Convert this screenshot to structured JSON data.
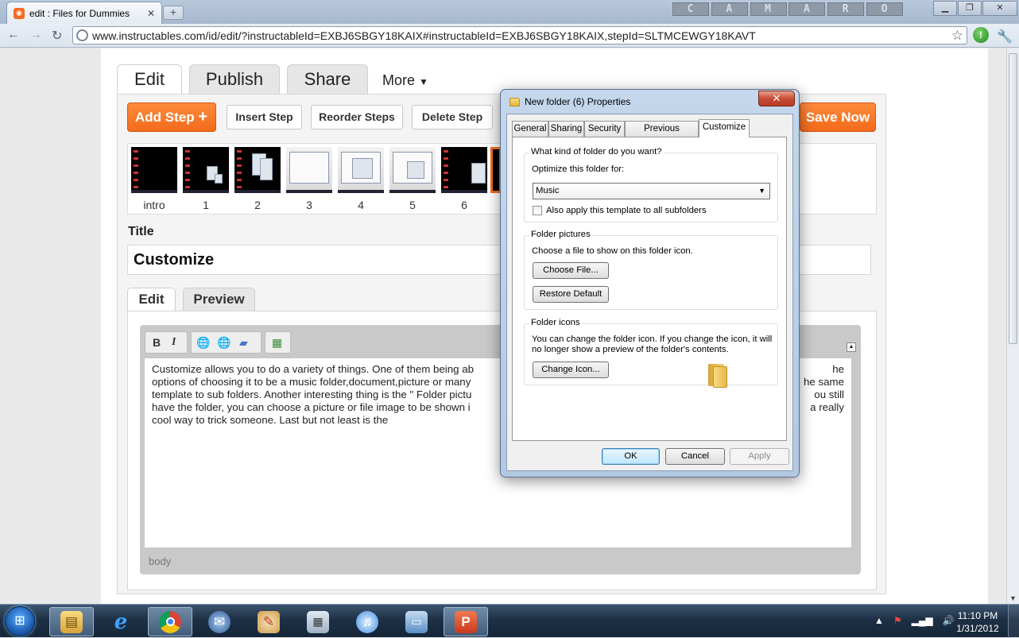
{
  "browser": {
    "tab_title": "edit : Files for Dummies",
    "tab_favicon": "instructables-logo-icon",
    "theme_logo_letters": [
      "C",
      "A",
      "M",
      "A",
      "R",
      "O"
    ],
    "url": "www.instructables.com/id/edit/?instructableId=EXBJ6SBGY18KAIX#instructableId=EXBJ6SBGY18KAIX,stepId=SLTMCEWGY18KAVT"
  },
  "page": {
    "tabs": [
      {
        "label": "Edit",
        "active": true
      },
      {
        "label": "Publish",
        "active": false
      },
      {
        "label": "Share",
        "active": false
      }
    ],
    "more_label": "More",
    "actions": {
      "add_step": "Add Step",
      "insert_step": "Insert Step",
      "reorder_steps": "Reorder Steps",
      "delete_step": "Delete Step",
      "save_now": "Save Now"
    },
    "steps": [
      {
        "label": "intro",
        "style": "dark"
      },
      {
        "label": "1",
        "style": "dark"
      },
      {
        "label": "2",
        "style": "dark"
      },
      {
        "label": "3",
        "style": "light"
      },
      {
        "label": "4",
        "style": "light"
      },
      {
        "label": "5",
        "style": "light"
      },
      {
        "label": "6",
        "style": "dark"
      }
    ],
    "title_label": "Title",
    "title_value": "Customize",
    "editor_tabs": [
      {
        "label": "Edit",
        "active": true
      },
      {
        "label": "Preview",
        "active": false
      }
    ],
    "toolbar_icons": [
      "bold-icon",
      "italic-icon",
      "link-icon",
      "unlink-icon",
      "eraser-icon",
      "media-icon"
    ],
    "body_text": "Customize allows you to do a variety of things. One of them being ab                                                                                                   he options of choosing it to be a music folder,document,picture or many                                                                                           he same template to sub folders. Another interesting thing is the \" Folder pictu                                                                                          ou still have the folder, you can choose a picture or file image to be shown i                                                                                       a really cool way to trick someone. Last but not least is the",
    "body_lines": [
      "Customize allows you to do a variety of things. One of them being ab",
      "options of choosing it to be a music folder,document,picture or many",
      "template to sub folders. Another interesting thing is the \" Folder pictu",
      "have the folder, you can choose a picture or file image to be shown i",
      "cool way to trick someone. Last but not least is the"
    ],
    "body_lines_right": [
      "he",
      "he same",
      "ou still",
      "a really",
      ""
    ],
    "editor_status": "body"
  },
  "dialog": {
    "title": "New folder (6) Properties",
    "tabs": [
      "General",
      "Sharing",
      "Security",
      "Previous Versions",
      "Customize"
    ],
    "active_tab": "Customize",
    "group1_title": "What kind of folder do you want?",
    "optimize_label": "Optimize this folder for:",
    "optimize_value": "Music",
    "apply_subfolders": "Also apply this template to all subfolders",
    "group2_title": "Folder pictures",
    "pictures_text": "Choose a file to show on this folder icon.",
    "choose_file": "Choose File...",
    "restore_default": "Restore Default",
    "group3_title": "Folder icons",
    "icons_text_1": "You can change the folder icon. If you change the icon, it will",
    "icons_text_2": "no longer show a preview of the folder's contents.",
    "change_icon": "Change Icon...",
    "ok": "OK",
    "cancel": "Cancel",
    "apply": "Apply"
  },
  "taskbar": {
    "apps": [
      "explorer-icon",
      "internet-explorer-icon",
      "chrome-icon",
      "thunderbird-icon",
      "paint-icon",
      "calculator-icon",
      "itunes-icon",
      "network-icon",
      "powerpoint-icon"
    ],
    "time": "11:10 PM",
    "date": "1/31/2012"
  }
}
